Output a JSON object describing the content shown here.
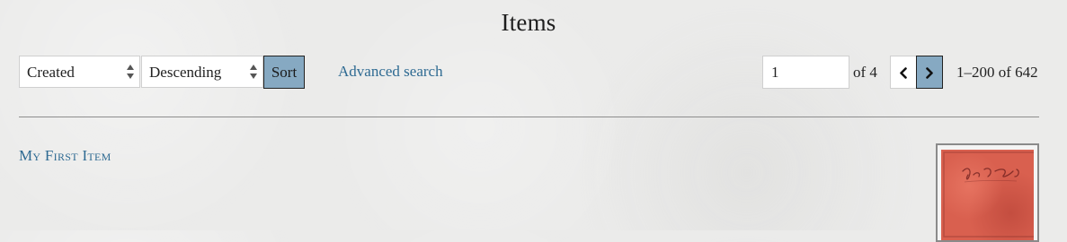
{
  "page": {
    "title": "Items"
  },
  "sort": {
    "field_value": "Created",
    "order_value": "Descending",
    "button_label": "Sort"
  },
  "search": {
    "advanced_link": "Advanced search"
  },
  "pagination": {
    "current_page": "1",
    "of_label": "of 4",
    "range_label": "1–200 of 642",
    "prev_icon": "chevron-left-icon",
    "next_icon": "chevron-right-icon"
  },
  "items": [
    {
      "title": "My First Item",
      "thumbnail_text": "Life of Christ",
      "thumbnail_color": "#d9604f"
    }
  ],
  "colors": {
    "accent": "#86a9c2",
    "link": "#2e6a92",
    "background": "#ebebea"
  }
}
